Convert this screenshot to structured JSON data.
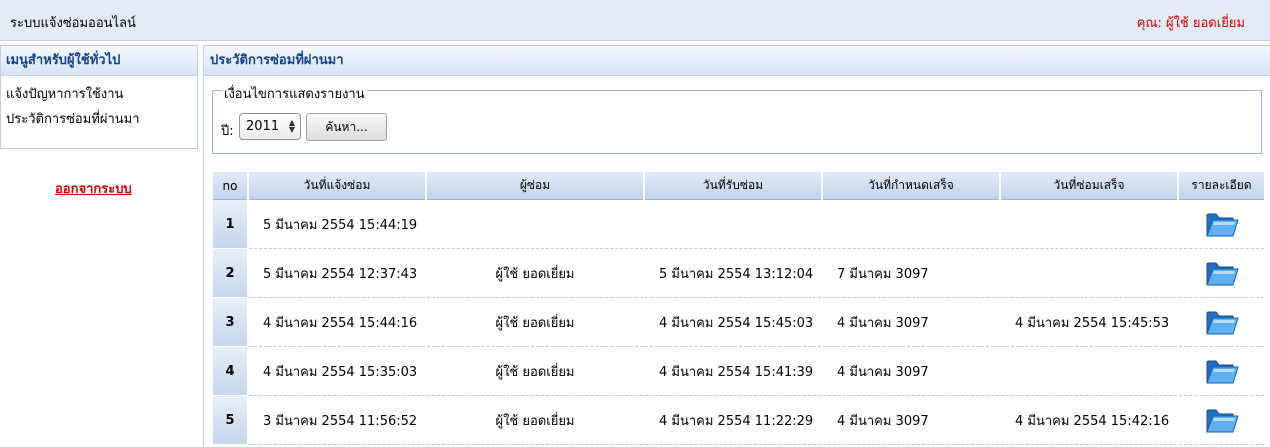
{
  "header": {
    "app_title": "ระบบแจ้งซ่อมออนไลน์",
    "user_label": "คุณ: ผู้ใช้ ยอดเยี่ยม"
  },
  "sidebar": {
    "title": "เมนูสำหรับผู้ใช้ทั่วไป",
    "items": [
      {
        "label": "แจ้งปัญหาการใช้งาน"
      },
      {
        "label": "ประวัติการซ่อมที่ผ่านมา"
      }
    ],
    "logout_label": "ออกจากระบบ"
  },
  "main": {
    "title": "ประวัติการซ่อมที่ผ่านมา",
    "filter": {
      "legend": "เงื่อนไขการแสดงรายงาน",
      "year_label": "ปี:",
      "year_value": "2011",
      "search_label": "ค้นหา..."
    },
    "table": {
      "columns": [
        "no",
        "วันที่แจ้งซ่อม",
        "ผู้ซ่อม",
        "วันที่รับซ่อม",
        "วันที่กำหนดเสร็จ",
        "วันที่ซ่อมเสร็จ",
        "รายละเอียด"
      ],
      "rows": [
        {
          "no": "1",
          "reported": "5 มีนาคม 2554 15:44:19",
          "technician": "",
          "received": "",
          "due": "",
          "completed": "",
          "detail_icon": "folder-open-icon"
        },
        {
          "no": "2",
          "reported": "5 มีนาคม 2554 12:37:43",
          "technician": "ผู้ใช้ ยอดเยี่ยม",
          "received": "5 มีนาคม 2554 13:12:04",
          "due": "7 มีนาคม 3097",
          "completed": "",
          "detail_icon": "folder-open-icon"
        },
        {
          "no": "3",
          "reported": "4 มีนาคม 2554 15:44:16",
          "technician": "ผู้ใช้ ยอดเยี่ยม",
          "received": "4 มีนาคม 2554 15:45:03",
          "due": "4 มีนาคม 3097",
          "completed": "4 มีนาคม 2554 15:45:53",
          "detail_icon": "folder-open-icon"
        },
        {
          "no": "4",
          "reported": "4 มีนาคม 2554 15:35:03",
          "technician": "ผู้ใช้ ยอดเยี่ยม",
          "received": "4 มีนาคม 2554 15:41:39",
          "due": "4 มีนาคม 3097",
          "completed": "",
          "detail_icon": "folder-open-icon"
        },
        {
          "no": "5",
          "reported": "3 มีนาคม 2554 11:56:52",
          "technician": "ผู้ใช้ ยอดเยี่ยม",
          "received": "4 มีนาคม 2554 11:22:29",
          "due": "4 มีนาคม 3097",
          "completed": "4 มีนาคม 2554 15:42:16",
          "detail_icon": "folder-open-icon"
        }
      ]
    }
  },
  "colors": {
    "header_bg": "#e4ebf5",
    "panel_title": "#15428b",
    "user_text": "#cc0000",
    "logout_text": "#dd0000"
  }
}
